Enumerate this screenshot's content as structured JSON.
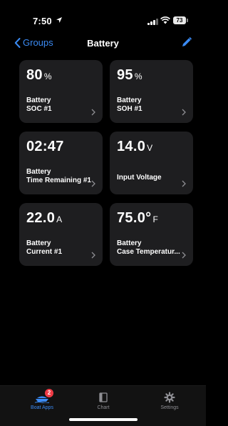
{
  "status_bar": {
    "time": "7:50",
    "battery_level": "73"
  },
  "nav": {
    "back_label": "Groups",
    "title": "Battery",
    "accent_color": "#3b8bf4"
  },
  "tiles": [
    {
      "value": "80",
      "unit": "%",
      "label_lines": [
        "Battery",
        "SOC #1"
      ]
    },
    {
      "value": "95",
      "unit": "%",
      "label_lines": [
        "Battery",
        "SOH #1"
      ]
    },
    {
      "value": "02:47",
      "unit": "",
      "label_lines": [
        "Battery",
        "Time Remaining #1"
      ]
    },
    {
      "value": "14.0",
      "unit": "V",
      "label_lines": [
        "Input Voltage"
      ]
    },
    {
      "value": "22.0",
      "unit": "A",
      "label_lines": [
        "Battery",
        "Current #1"
      ]
    },
    {
      "value": "75.0°",
      "unit": "F",
      "label_lines": [
        "Battery",
        "Case Temperatur..."
      ]
    }
  ],
  "tab_bar": {
    "tabs": [
      {
        "label": "Boat Apps",
        "icon": "boat-icon",
        "badge": "2",
        "active": true
      },
      {
        "label": "Chart",
        "icon": "chart-page-icon",
        "active": false
      },
      {
        "label": "Settings",
        "icon": "gear-icon",
        "active": false
      }
    ]
  }
}
